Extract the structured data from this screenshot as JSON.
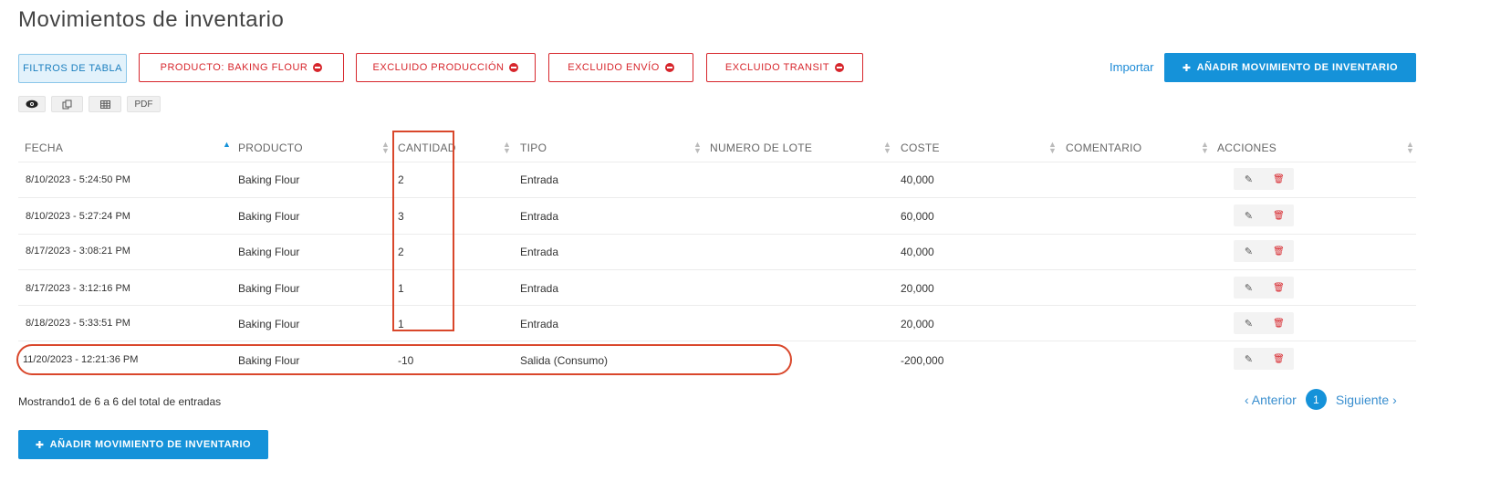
{
  "page": {
    "title": "Movimientos de inventario"
  },
  "toolbar": {
    "filters_label": "FILTROS DE TABLA",
    "active_filters": [
      {
        "label": "PRODUCTO: BAKING FLOUR"
      },
      {
        "label": "EXCLUIDO PRODUCCIÓN"
      },
      {
        "label": "EXCLUIDO ENVÍO"
      },
      {
        "label": "EXCLUIDO TRANSIT"
      }
    ],
    "import_label": "Importar",
    "add_label": "AÑADIR MOVIMIENTO DE INVENTARIO",
    "tools": [
      {
        "icon": "eye-icon"
      },
      {
        "icon": "copy-icon"
      },
      {
        "icon": "table-icon"
      },
      {
        "label": "PDF"
      }
    ]
  },
  "table": {
    "columns": [
      "FECHA",
      "PRODUCTO",
      "CANTIDAD",
      "TIPO",
      "NUMERO DE LOTE",
      "COSTE",
      "COMENTARIO",
      "ACCIONES"
    ],
    "rows": [
      {
        "fecha": "8/10/2023 - 5:24:50 PM",
        "producto": "Baking Flour",
        "cantidad": "2",
        "tipo": "Entrada",
        "lote": "",
        "coste": "40,000",
        "comentario": ""
      },
      {
        "fecha": "8/10/2023 - 5:27:24 PM",
        "producto": "Baking Flour",
        "cantidad": "3",
        "tipo": "Entrada",
        "lote": "",
        "coste": "60,000",
        "comentario": ""
      },
      {
        "fecha": "8/17/2023 - 3:08:21 PM",
        "producto": "Baking Flour",
        "cantidad": "2",
        "tipo": "Entrada",
        "lote": "",
        "coste": "40,000",
        "comentario": ""
      },
      {
        "fecha": "8/17/2023 - 3:12:16 PM",
        "producto": "Baking Flour",
        "cantidad": "1",
        "tipo": "Entrada",
        "lote": "",
        "coste": "20,000",
        "comentario": ""
      },
      {
        "fecha": "8/18/2023 - 5:33:51 PM",
        "producto": "Baking Flour",
        "cantidad": "1",
        "tipo": "Entrada",
        "lote": "",
        "coste": "20,000",
        "comentario": ""
      },
      {
        "fecha": "11/20/2023 - 12:21:36 PM",
        "producto": "Baking Flour",
        "cantidad": "-10",
        "tipo": "Salida (Consumo)",
        "lote": "",
        "coste": "-200,000",
        "comentario": ""
      }
    ]
  },
  "footer": {
    "info": "Mostrando1 de 6 a 6 del total de entradas",
    "pagination": {
      "prev": "Anterior",
      "current": "1",
      "next": "Siguiente"
    },
    "add_label": "AÑADIR MOVIMIENTO DE INVENTARIO"
  },
  "colors": {
    "primary": "#1592d9",
    "danger": "#d7262c",
    "annotation": "#d9472b"
  }
}
